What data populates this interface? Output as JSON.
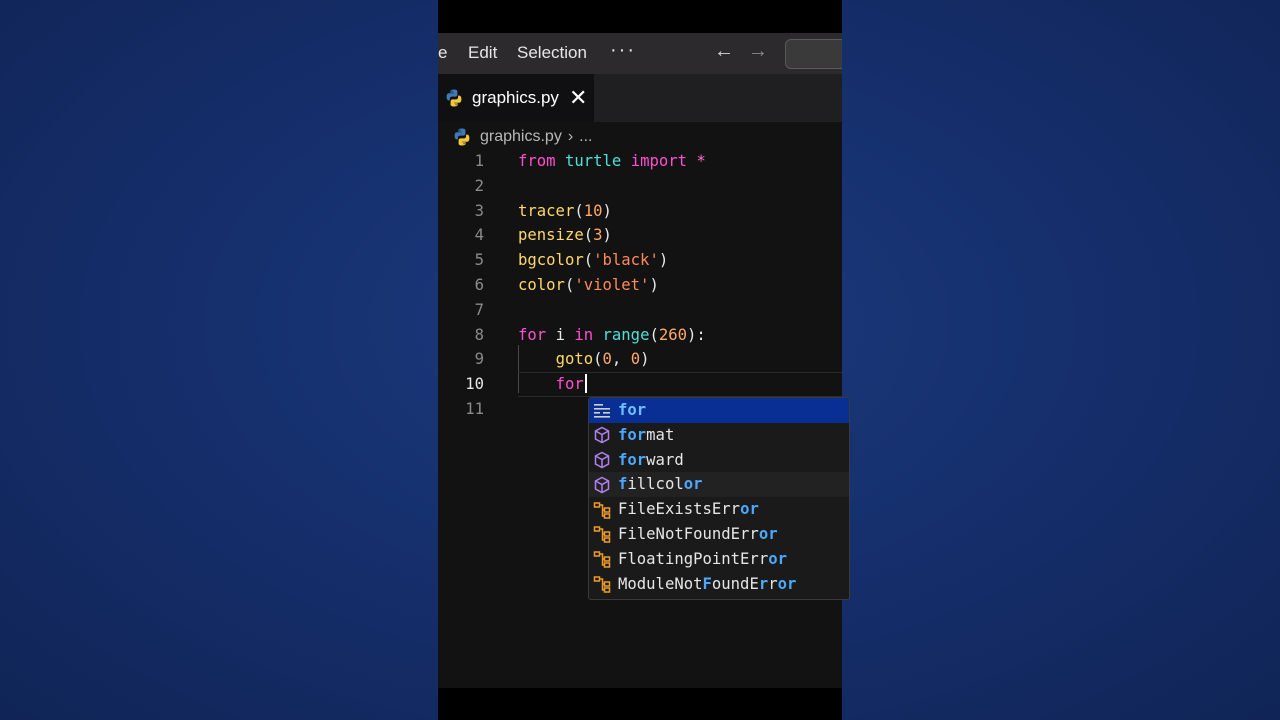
{
  "menubar": {
    "file": "e",
    "edit": "Edit",
    "selection": "Selection",
    "more": "···",
    "back_icon": "arrow-left-icon",
    "forward_icon": "arrow-right-icon"
  },
  "tab": {
    "label": "graphics.py",
    "close": "✕",
    "icon": "python-icon"
  },
  "breadcrumb": {
    "file": "graphics.py",
    "separator": "›",
    "more": "..."
  },
  "editor": {
    "current_line": 10,
    "lines": [
      {
        "n": "1"
      },
      {
        "n": "2"
      },
      {
        "n": "3"
      },
      {
        "n": "4"
      },
      {
        "n": "5"
      },
      {
        "n": "6"
      },
      {
        "n": "7"
      },
      {
        "n": "8"
      },
      {
        "n": "9"
      },
      {
        "n": "10"
      },
      {
        "n": "11"
      }
    ],
    "code": {
      "l1_from": "from",
      "l1_mod": "turtle",
      "l1_import": "import",
      "l1_star": "*",
      "l3_fn": "tracer",
      "l3_arg": "10",
      "l4_fn": "pensize",
      "l4_arg": "3",
      "l5_fn": "bgcolor",
      "l5_arg": "'black'",
      "l6_fn": "color",
      "l6_arg": "'violet'",
      "l8_for": "for",
      "l8_var": "i",
      "l8_in": "in",
      "l8_fn": "range",
      "l8_arg": "260",
      "l9_fn": "goto",
      "l9_a": "0",
      "l9_b": "0",
      "l10_typed": "for"
    }
  },
  "suggestions": [
    {
      "pre": "",
      "hl": "for",
      "post": "",
      "icon": "snippet-icon"
    },
    {
      "pre": "",
      "hl": "for",
      "post": "mat",
      "icon": "method-cube-icon"
    },
    {
      "pre": "",
      "hl": "for",
      "post": "ward",
      "icon": "method-cube-icon"
    },
    {
      "pre": "f",
      "mid": "illcol",
      "hl": "or",
      "post": "",
      "icon": "method-cube-icon"
    },
    {
      "pre": "FileExistsErr",
      "hl": "or",
      "post": "",
      "icon": "class-icon"
    },
    {
      "pre": "FileNotFoundErr",
      "hl": "or",
      "post": "",
      "icon": "class-icon"
    },
    {
      "pre": "FloatingPointErr",
      "hl": "or",
      "post": "",
      "icon": "class-icon"
    },
    {
      "pre": "ModuleNotFoundError",
      "hl": "",
      "post": "",
      "icon": "class-icon"
    }
  ],
  "colors": {
    "keyword": "#ff4fd0",
    "function": "#ffd866",
    "module": "#4fe0d8",
    "number": "#ffa868",
    "string": "#ff8a5a",
    "selection": "#0a2f94",
    "match_highlight": "#4aa8ff"
  }
}
